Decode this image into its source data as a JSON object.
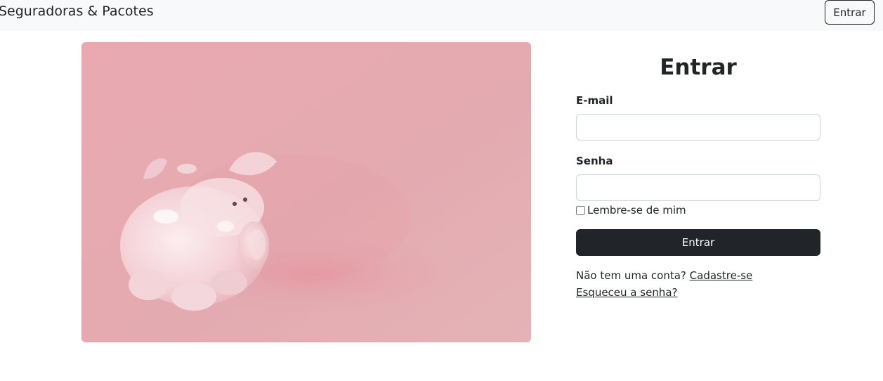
{
  "navbar": {
    "brand": "Seguradoras & Pacotes",
    "login_button": "Entrar"
  },
  "hero": {
    "image": "piggy-bank-photo",
    "background_color": "#e6aab1"
  },
  "login_form": {
    "title": "Entrar",
    "email_label": "E-mail",
    "email_value": "",
    "password_label": "Senha",
    "password_value": "",
    "remember_label": "Lembre-se de mim",
    "remember_checked": false,
    "submit_label": "Entrar",
    "no_account_text": "Não tem uma conta?",
    "register_link": "Cadastre-se",
    "forgot_link": "Esqueceu a senha?"
  },
  "colors": {
    "primary_dark": "#212529",
    "navbar_bg": "#f8f9fa",
    "border": "#ced4da"
  }
}
